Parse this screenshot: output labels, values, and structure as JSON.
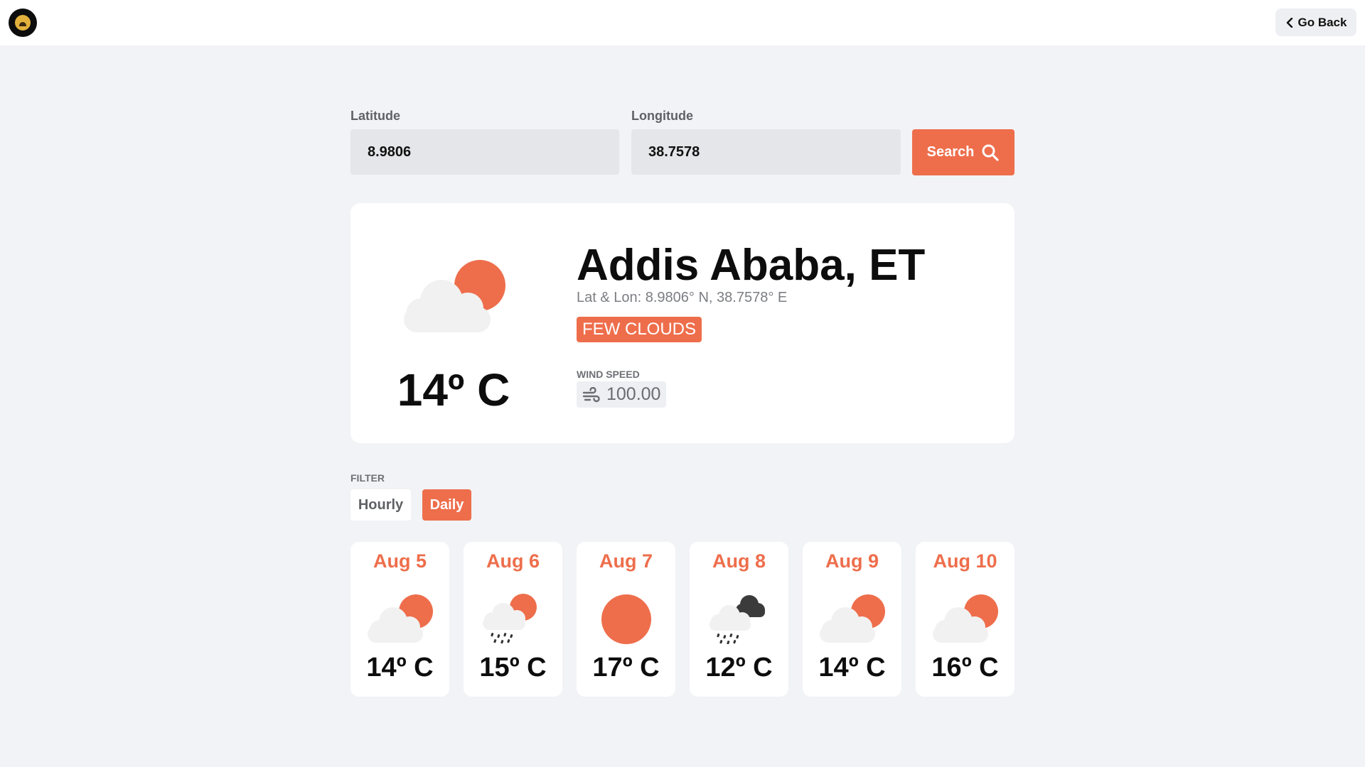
{
  "header": {
    "go_back_label": "Go Back"
  },
  "search": {
    "latitude_label": "Latitude",
    "latitude_value": "8.9806",
    "longitude_label": "Longitude",
    "longitude_value": "38.7578",
    "search_label": "Search"
  },
  "current": {
    "city": "Addis Ababa, ET",
    "coords": "Lat & Lon: 8.9806° N, 38.7578° E",
    "condition": "FEW CLOUDS",
    "condition_icon": "cloud-sun-icon",
    "temperature": "14º C",
    "wind_label": "WIND SPEED",
    "wind_value": "100.00",
    "wind_icon": "wind-icon"
  },
  "filter": {
    "label": "FILTER",
    "hourly_label": "Hourly",
    "daily_label": "Daily",
    "selected": "Daily"
  },
  "forecast": [
    {
      "date": "Aug 5",
      "temp": "14º C",
      "icon": "cloud-sun-icon"
    },
    {
      "date": "Aug 6",
      "temp": "15º C",
      "icon": "rain-sun-icon"
    },
    {
      "date": "Aug 7",
      "temp": "17º C",
      "icon": "sun-icon"
    },
    {
      "date": "Aug 8",
      "temp": "12º C",
      "icon": "rain-dark-cloud-icon"
    },
    {
      "date": "Aug 9",
      "temp": "14º C",
      "icon": "cloud-sun-icon"
    },
    {
      "date": "Aug 10",
      "temp": "16º C",
      "icon": "cloud-sun-icon"
    }
  ],
  "colors": {
    "accent": "#ee6e4c",
    "background": "#f2f3f6",
    "card": "#ffffff",
    "input": "#e5e6ea",
    "cloud": "#f1f1f1",
    "dark_cloud": "#3b3b3b"
  }
}
